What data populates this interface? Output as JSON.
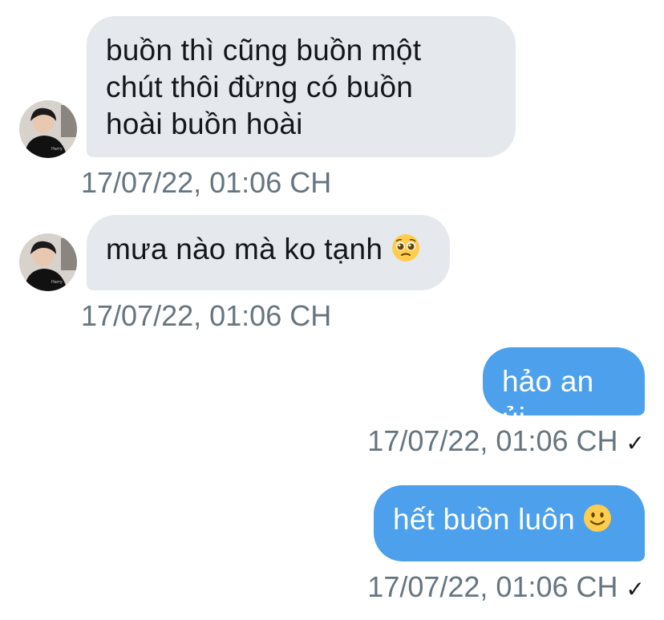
{
  "messages": [
    {
      "direction": "incoming",
      "lines": [
        "buồn thì cũng buồn một",
        "chút thôi đừng có buồn",
        "hoài buồn hoài"
      ],
      "time": "17/07/22, 01:06 CH"
    },
    {
      "direction": "incoming",
      "text": "mưa nào mà ko tạnh",
      "emoji": "pleading-face-icon",
      "time": "17/07/22, 01:06 CH"
    },
    {
      "direction": "outgoing",
      "text": "hảo an ủi",
      "time": "17/07/22, 01:06 CH",
      "status": "✓"
    },
    {
      "direction": "outgoing",
      "text": "hết buồn luôn",
      "emoji": "slightly-smiling-face-icon",
      "time": "17/07/22, 01:06 CH",
      "status": "✓"
    }
  ],
  "colors": {
    "incoming_bubble": "#e5e9ee",
    "outgoing_bubble": "#4ca0ec",
    "timestamp": "#66757f",
    "text_dark": "#14171a"
  }
}
